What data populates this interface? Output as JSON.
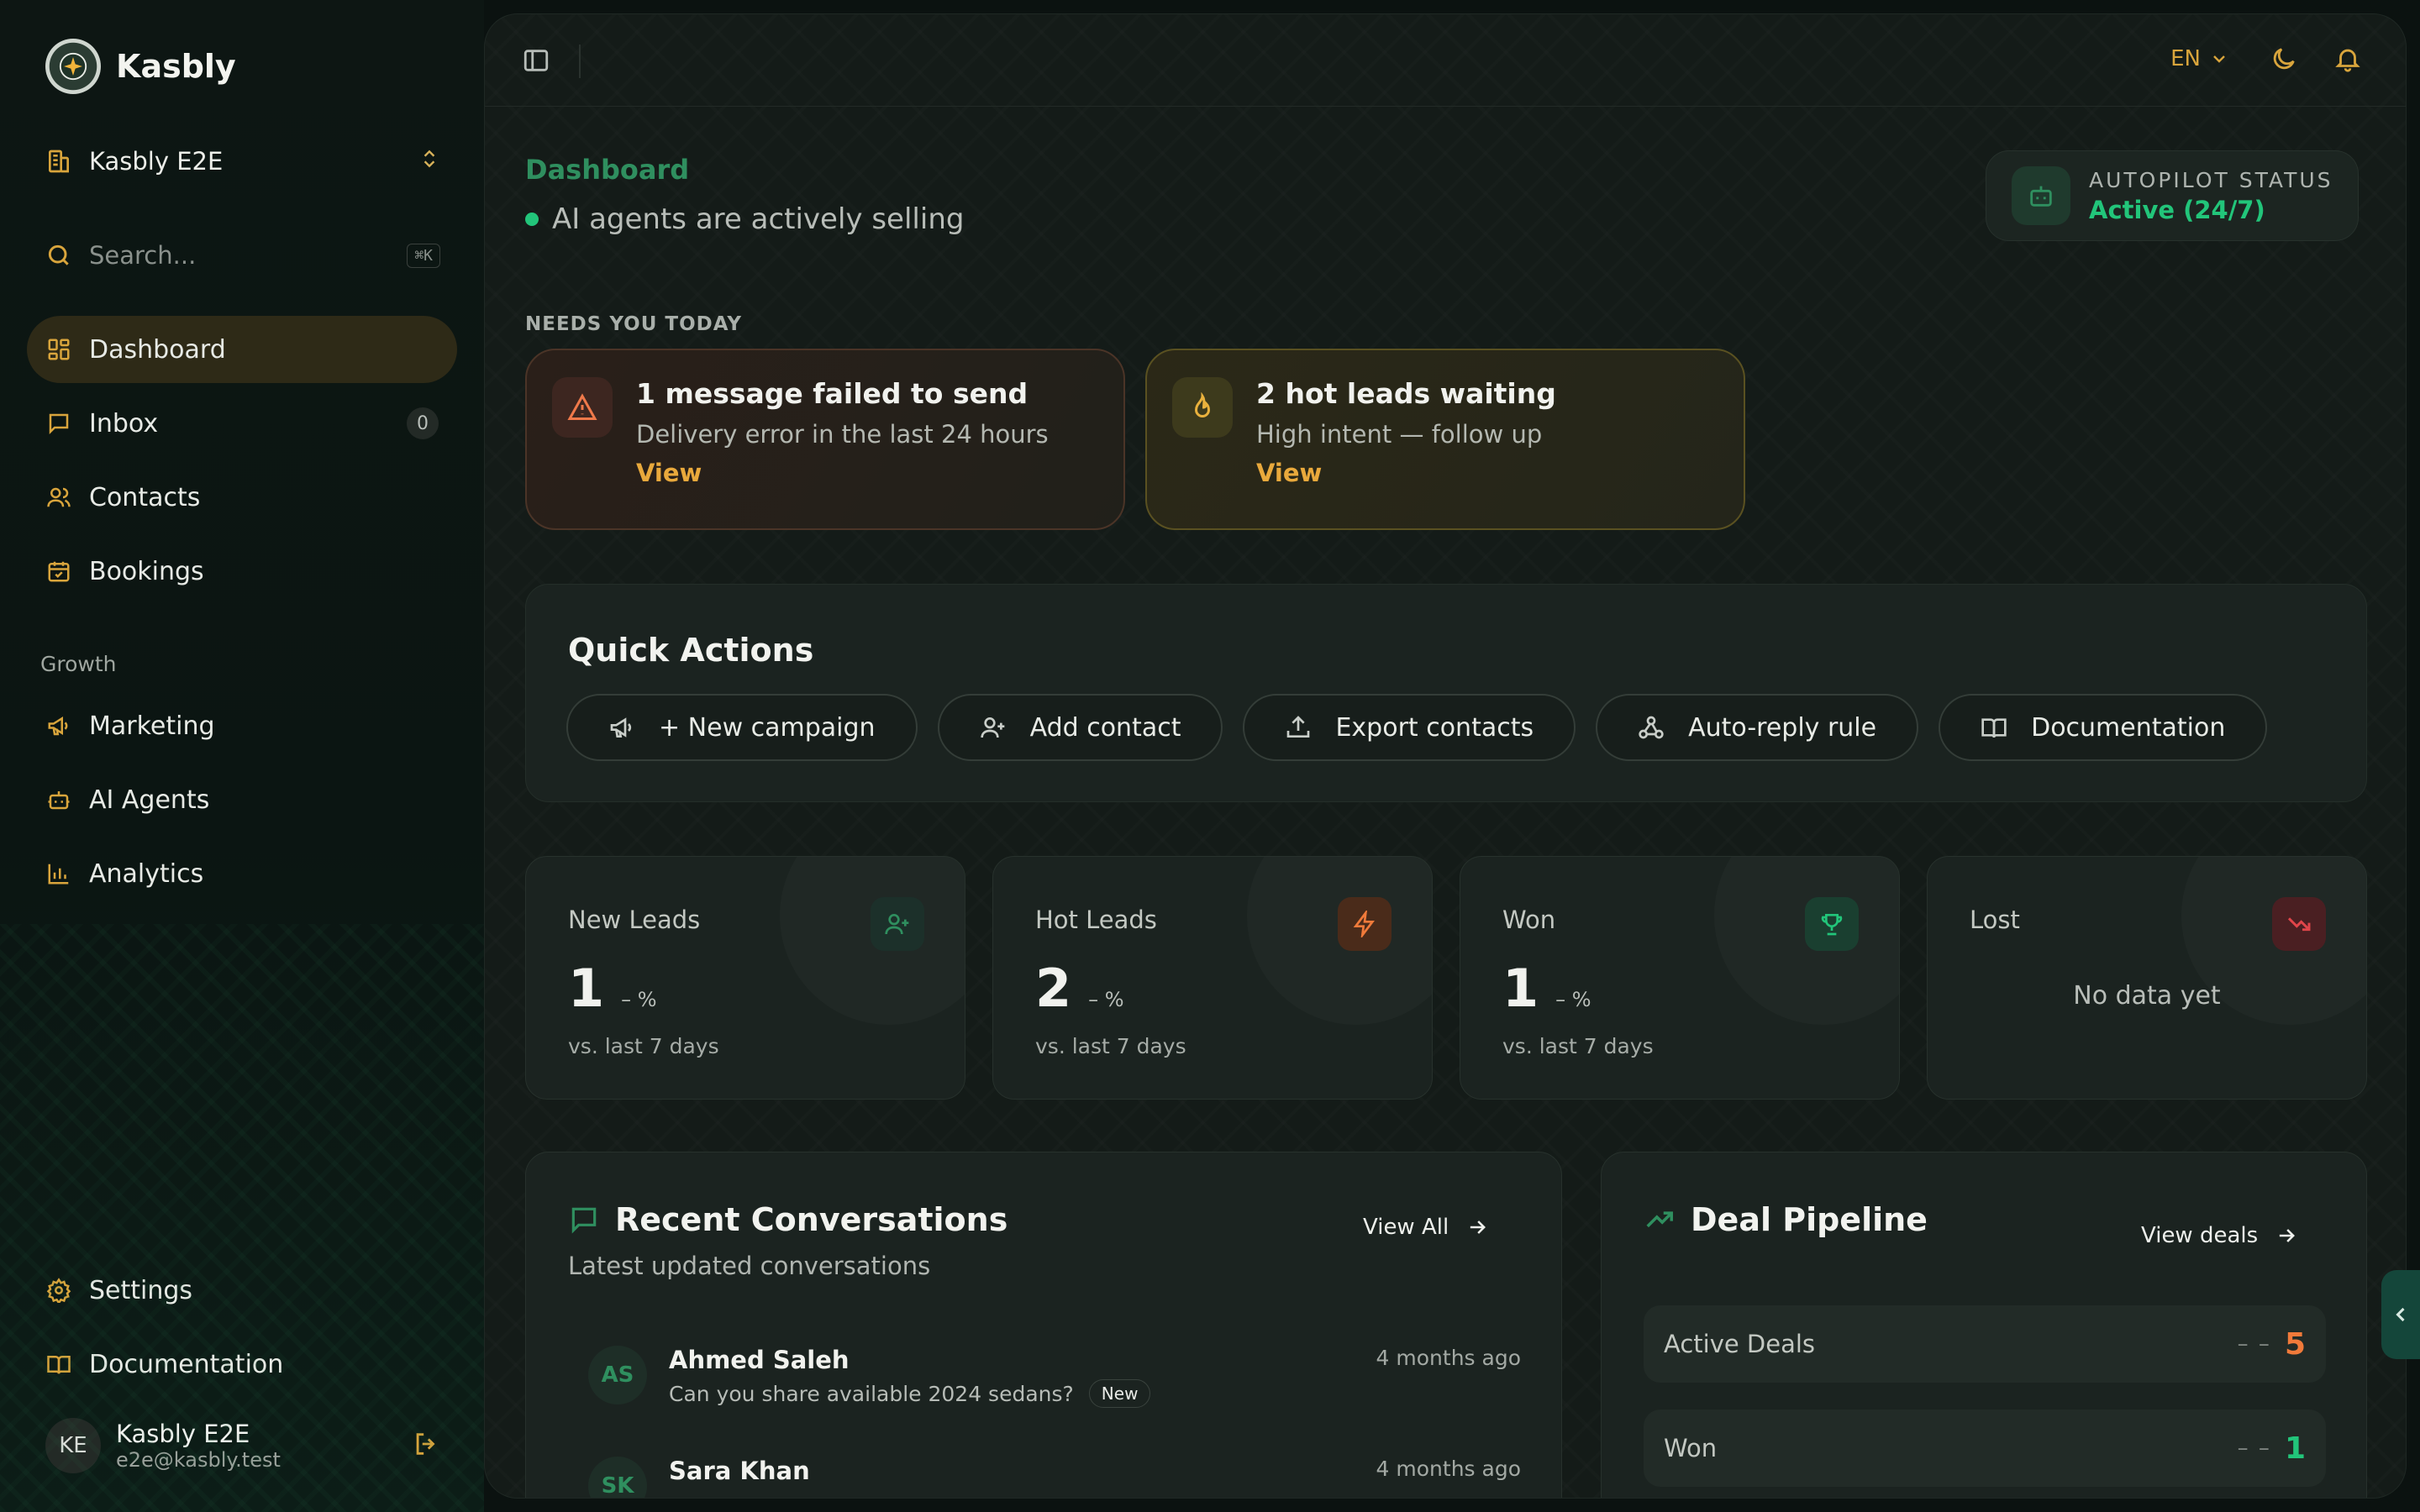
{
  "brand": {
    "name": "Kasbly"
  },
  "workspace": {
    "name": "Kasbly E2E"
  },
  "search": {
    "placeholder": "Search...",
    "shortcut": "⌘K"
  },
  "nav": {
    "main": [
      {
        "label": "Dashboard",
        "icon": "dashboard-icon",
        "active": true
      },
      {
        "label": "Inbox",
        "icon": "inbox-icon",
        "count": "0"
      },
      {
        "label": "Contacts",
        "icon": "contacts-icon"
      },
      {
        "label": "Bookings",
        "icon": "calendar-icon"
      }
    ],
    "growth_label": "Growth",
    "growth": [
      {
        "label": "Marketing",
        "icon": "megaphone-icon"
      },
      {
        "label": "AI Agents",
        "icon": "bot-icon"
      },
      {
        "label": "Analytics",
        "icon": "bar-chart-icon"
      }
    ],
    "bottom": [
      {
        "label": "Settings",
        "icon": "gear-icon"
      },
      {
        "label": "Documentation",
        "icon": "book-icon"
      }
    ]
  },
  "user": {
    "initials": "KE",
    "name": "Kasbly E2E",
    "email": "e2e@kasbly.test"
  },
  "topbar": {
    "language": "EN"
  },
  "header": {
    "breadcrumb": "Dashboard",
    "subtitle": "AI agents are actively selling",
    "autopilot_label": "AUTOPILOT STATUS",
    "autopilot_value": "Active (24/7)"
  },
  "needs_today": {
    "label": "NEEDS YOU TODAY",
    "cards": [
      {
        "title": "1 message failed to send",
        "subtitle": "Delivery error in the last 24 hours",
        "link": "View",
        "icon": "warning-icon"
      },
      {
        "title": "2 hot leads waiting",
        "subtitle": "High intent — follow up",
        "link": "View",
        "icon": "flame-icon"
      }
    ]
  },
  "quick_actions": {
    "title": "Quick Actions",
    "buttons": [
      {
        "label": "+ New campaign",
        "icon": "megaphone-icon"
      },
      {
        "label": "Add contact",
        "icon": "user-plus-icon"
      },
      {
        "label": "Export contacts",
        "icon": "upload-icon"
      },
      {
        "label": "Auto-reply rule",
        "icon": "webhook-icon"
      },
      {
        "label": "Documentation",
        "icon": "book-icon"
      }
    ]
  },
  "stats": [
    {
      "label": "New Leads",
      "value": "1",
      "pct": "– %",
      "compare": "vs. last 7 days",
      "icon": "user-plus-icon",
      "color": "#2f8f5f"
    },
    {
      "label": "Hot Leads",
      "value": "2",
      "pct": "– %",
      "compare": "vs. last 7 days",
      "icon": "lightning-icon",
      "color": "#f07a3a"
    },
    {
      "label": "Won",
      "value": "1",
      "pct": "– %",
      "compare": "vs. last 7 days",
      "icon": "trophy-icon",
      "color": "#22c57a"
    },
    {
      "label": "Lost",
      "empty": "No data yet",
      "icon": "trend-down-icon",
      "color": "#e0454a"
    }
  ],
  "conversations": {
    "title": "Recent Conversations",
    "subtitle": "Latest updated conversations",
    "view_all": "View All",
    "rows": [
      {
        "initials": "AS",
        "name": "Ahmed Saleh",
        "message": "Can you share available 2024 sedans?",
        "tag": "New",
        "time": "4 months ago"
      },
      {
        "initials": "SK",
        "name": "Sara Khan",
        "message": "",
        "tag": "",
        "time": "4 months ago"
      }
    ]
  },
  "pipeline": {
    "title": "Deal Pipeline",
    "view_deals": "View deals",
    "rows": [
      {
        "label": "Active Deals",
        "dash": "– –",
        "value": "5",
        "color": "#f07a3a"
      },
      {
        "label": "Won",
        "dash": "– –",
        "value": "1",
        "color": "#22c57a"
      }
    ]
  },
  "colors": {
    "accent": "#d9a53c",
    "success": "#22c57a",
    "brand_green": "#2f8f5f",
    "danger": "#e0454a",
    "warning": "#f07a3a"
  }
}
